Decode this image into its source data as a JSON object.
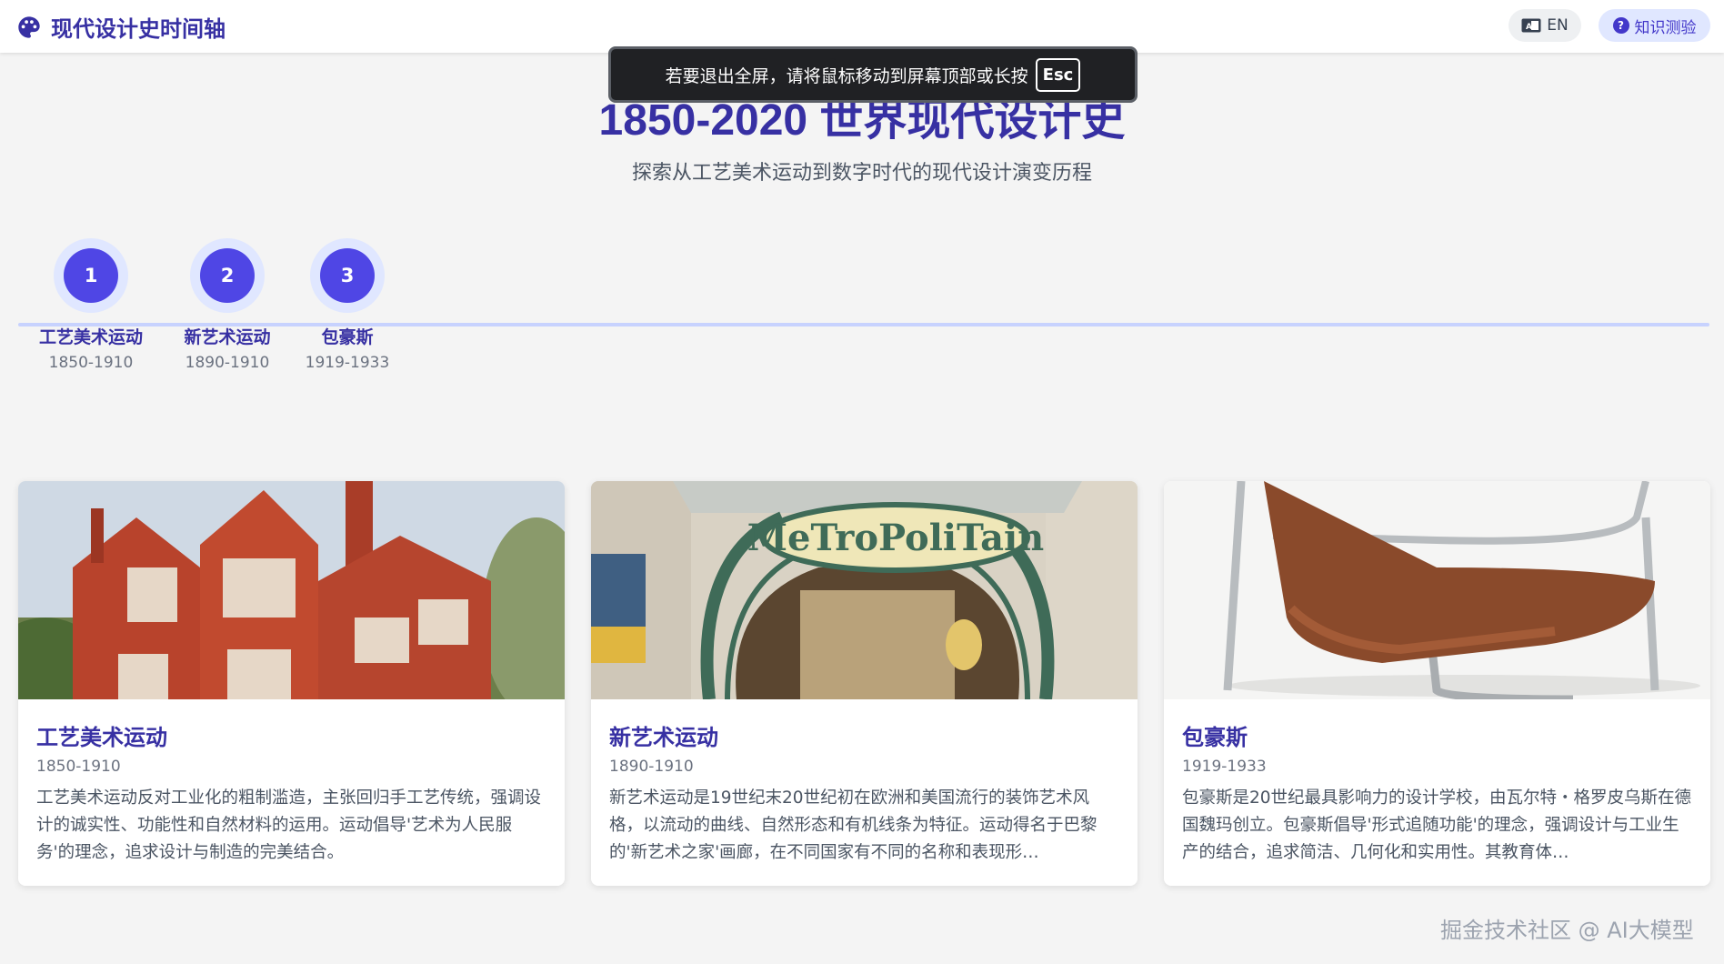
{
  "header": {
    "brand_icon": "palette-icon",
    "brand_title": "现代设计史时间轴",
    "lang_button": {
      "icon": "translate-icon",
      "label": "EN"
    },
    "quiz_button": {
      "icon": "question-icon",
      "label": "知识测验"
    }
  },
  "hero": {
    "title": "1850-2020 世界现代设计史",
    "subtitle": "探索从工艺美术运动到数字时代的现代设计演变历程"
  },
  "fullscreen_toast": {
    "message": "若要退出全屏，请将鼠标移动到屏幕顶部或长按",
    "key": "Esc"
  },
  "timeline": [
    {
      "number": "1",
      "label": "工艺美术运动",
      "date": "1850-1910"
    },
    {
      "number": "2",
      "label": "新艺术运动",
      "date": "1890-1910"
    },
    {
      "number": "3",
      "label": "包豪斯",
      "date": "1919-1933"
    }
  ],
  "cards": [
    {
      "title": "工艺美术运动",
      "date": "1850-1910",
      "description": "工艺美术运动反对工业化的粗制滥造，主张回归手工艺传统，强调设计的诚实性、功能性和自然材料的运用。运动倡导'艺术为人民服务'的理念，追求设计与制造的完美结合。",
      "image": "red-brick-house-photo"
    },
    {
      "title": "新艺术运动",
      "date": "1890-1910",
      "description": "新艺术运动是19世纪末20世纪初在欧洲和美国流行的装饰艺术风格，以流动的曲线、自然形态和有机线条为特征。运动得名于巴黎的'新艺术之家'画廊，在不同国家有不同的名称和表现形…",
      "image": "metro-entrance-photo",
      "sign_text": "MeTroPoliTain"
    },
    {
      "title": "包豪斯",
      "date": "1919-1933",
      "description": "包豪斯是20世纪最具影响力的设计学校，由瓦尔特・格罗皮乌斯在德国魏玛创立。包豪斯倡导'形式追随功能'的理念，强调设计与工业生产的结合，追求简洁、几何化和实用性。其教育体…",
      "image": "leather-chair-photo"
    }
  ],
  "watermark": "掘金技术社区 @ AI大模型",
  "colors": {
    "primary": "#3730a3",
    "accent": "#4f46e5",
    "timeline_line": "#c7d2fe",
    "background": "#f4f4f4"
  }
}
